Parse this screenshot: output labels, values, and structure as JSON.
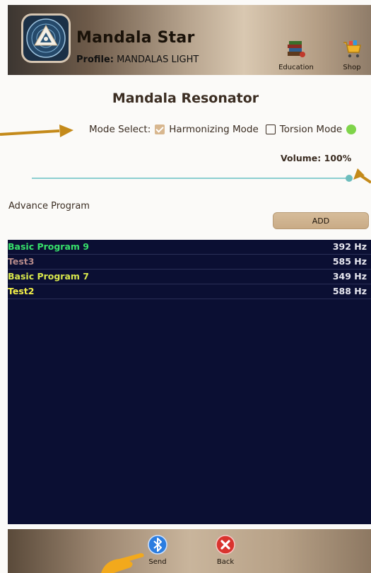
{
  "header": {
    "app_title": "Mandala Star",
    "profile_label": "Profile:",
    "profile_value": "MANDALAS LIGHT",
    "education_label": "Education",
    "shop_label": "Shop"
  },
  "screen_title": "Mandala Resonator",
  "mode": {
    "label": "Mode Select:",
    "harmonizing_label": "Harmonizing Mode",
    "harmonizing_checked": true,
    "torsion_label": "Torsion Mode",
    "torsion_checked": false,
    "status_color": "#7fd44a"
  },
  "volume": {
    "label": "Volume: 100%",
    "level": 1.0
  },
  "advance": {
    "label": "Advance Program",
    "add_label": "ADD"
  },
  "programs": [
    {
      "name": "Basic Program 9",
      "hz": "392 Hz",
      "color": "#37e06a"
    },
    {
      "name": "Test3",
      "hz": "585 Hz",
      "color": "#b58a8a"
    },
    {
      "name": "Basic Program 7",
      "hz": "349 Hz",
      "color": "#d8e84c"
    },
    {
      "name": "Test2",
      "hz": "588 Hz",
      "color": "#f2ee48"
    }
  ],
  "footer": {
    "send_label": "Send",
    "back_label": "Back"
  },
  "colors": {
    "accent": "#d8b78f",
    "list_bg": "#0b0f33",
    "annotation_arrow": "#c48a1a"
  }
}
